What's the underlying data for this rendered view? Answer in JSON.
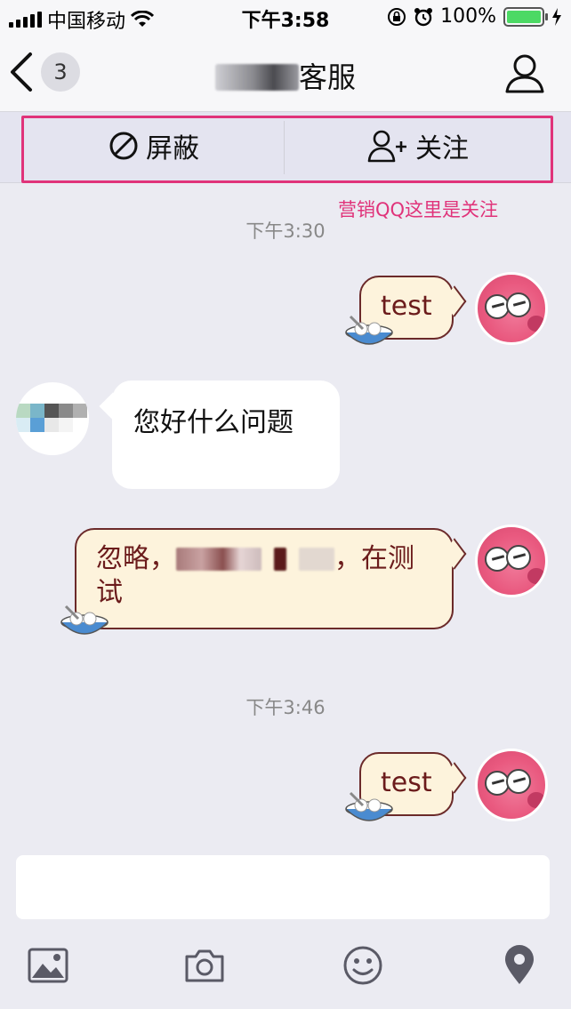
{
  "status_bar": {
    "carrier": "中国移动",
    "time": "下午3:58",
    "battery_percent": "100%",
    "battery_level": 1.0
  },
  "nav": {
    "back_badge_count": "3",
    "title_suffix": "客服"
  },
  "actions": {
    "block_label": "屏蔽",
    "follow_label": "关注"
  },
  "annotation": "营销QQ这里是关注",
  "messages": [
    {
      "type": "time",
      "text": "下午3:30"
    },
    {
      "type": "out",
      "text": "test"
    },
    {
      "type": "in",
      "text": "您好什么问题"
    },
    {
      "type": "out",
      "text_before": "忽略，",
      "text_after": "，在测试"
    },
    {
      "type": "time",
      "text": "下午3:46"
    },
    {
      "type": "out",
      "text": "test"
    }
  ],
  "input": {
    "placeholder": ""
  },
  "toolbar": [
    "image-icon",
    "camera-icon",
    "emoji-icon",
    "location-icon"
  ],
  "colors": {
    "annotation": "#e0337a",
    "outgoing_bubble": "#fdf3dc",
    "outgoing_text": "#6b1b1b",
    "background": "#ebebf2"
  }
}
